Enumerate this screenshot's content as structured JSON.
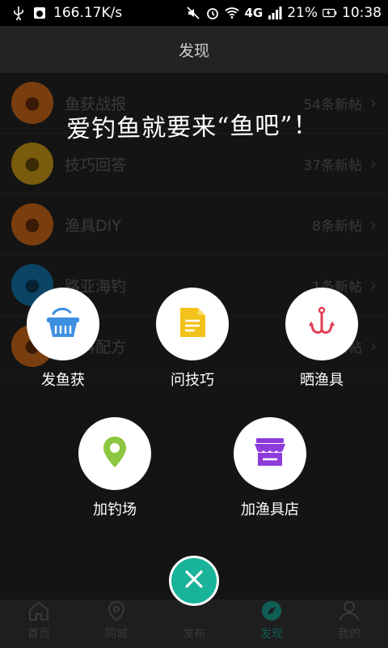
{
  "status_bar": {
    "speed": "166.17K/s",
    "network": "4G",
    "battery": "21%",
    "time": "10:38",
    "icons": [
      "usb-icon",
      "android-debug-icon",
      "mute-icon",
      "alarm-icon",
      "wifi-icon",
      "signal-icon",
      "battery-icon"
    ]
  },
  "header": {
    "title": "发现"
  },
  "list": [
    {
      "title": "鱼获战报",
      "count": "54条新帖",
      "color": "#7a3e0e"
    },
    {
      "title": "技巧回答",
      "count": "37条新帖",
      "color": "#7a5c0e"
    },
    {
      "title": "渔具DIY",
      "count": "8条新帖",
      "color": "#7a3e0e"
    },
    {
      "title": "路亚海钓",
      "count": "1条新帖",
      "color": "#0c4466"
    },
    {
      "title": "饵料配方",
      "count": "3条新帖",
      "color": "#7a3e0e"
    }
  ],
  "slogan": "爱钓鱼就要来“鱼吧”！",
  "actions": [
    {
      "label": "发鱼获",
      "icon": "fish-basket-icon",
      "color": "#3d8fe0"
    },
    {
      "label": "问技巧",
      "icon": "document-icon",
      "color": "#f2c21a"
    },
    {
      "label": "晒渔具",
      "icon": "fishing-hook-icon",
      "color": "#e23c54"
    },
    {
      "label": "加钓场",
      "icon": "location-pin-icon",
      "color": "#8dc63f"
    },
    {
      "label": "加渔具店",
      "icon": "shop-icon",
      "color": "#8e3bdc"
    }
  ],
  "tabs": [
    {
      "label": "首页",
      "icon": "home-icon"
    },
    {
      "label": "同城",
      "icon": "location-icon"
    },
    {
      "label": "发布",
      "icon": "publish-icon"
    },
    {
      "label": "发现",
      "icon": "compass-icon"
    },
    {
      "label": "我的",
      "icon": "user-icon"
    }
  ],
  "colors": {
    "accent": "#19b39a",
    "overlay": "#000000"
  }
}
